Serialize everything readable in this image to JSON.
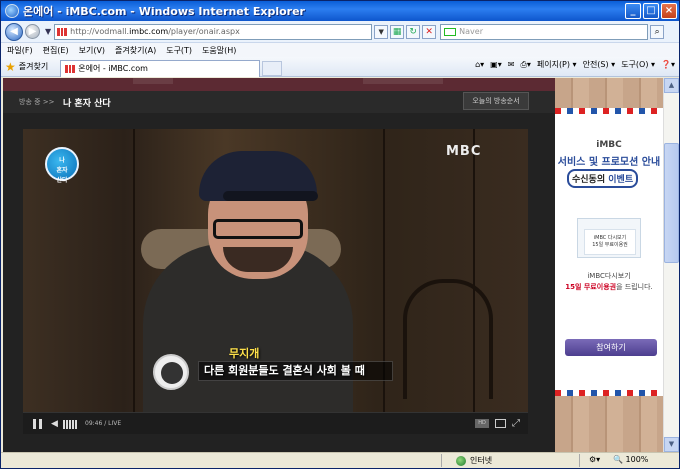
{
  "window": {
    "title": "온에어 - iMBC.com - Windows Internet Explorer",
    "minimize": "_",
    "maximize": "□",
    "close": "×"
  },
  "address": {
    "url_prefix": "http://vodmall.",
    "url_domain": "imbc.com",
    "url_suffix": "/player/onair.aspx",
    "search_placeholder": "Naver"
  },
  "menu": [
    "파일(F)",
    "편집(E)",
    "보기(V)",
    "즐겨찾기(A)",
    "도구(T)",
    "도움말(H)"
  ],
  "favorites": {
    "label": "즐겨찾기",
    "tab_title": "온에어 - iMBC.com"
  },
  "command_bar": [
    "페이지(P) ▾",
    "안전(S) ▾",
    "도구(O) ▾"
  ],
  "page": {
    "breadcrumb": "방송 중 >>",
    "program": "나 혼자 산다",
    "schedule_button": "오늘의 방송순서"
  },
  "player": {
    "channel_logo": "MBC",
    "show_logo_lines": [
      "나",
      "혼자",
      "산다"
    ],
    "subtitle_tag": "무지개",
    "subtitle": "다른 회원분들도 결혼식 사회 볼 때",
    "time": "09:46 / LIVE",
    "hd_label": "HD"
  },
  "ad": {
    "brand": "iMBC",
    "headline": "서비스 및 프로모션 안내",
    "pill_main": "수신동의",
    "pill_rest": " 이벤트",
    "card_line1": "iMBC 다시보기",
    "card_line2": "15일 무료이용권",
    "desc_line1": "iMBC다시보기",
    "desc_highlight": "15일 무료이용권",
    "desc_tail": "을 드립니다.",
    "join_button": "참여하기"
  },
  "status": {
    "zone": "인터넷",
    "zoom": "100%"
  }
}
